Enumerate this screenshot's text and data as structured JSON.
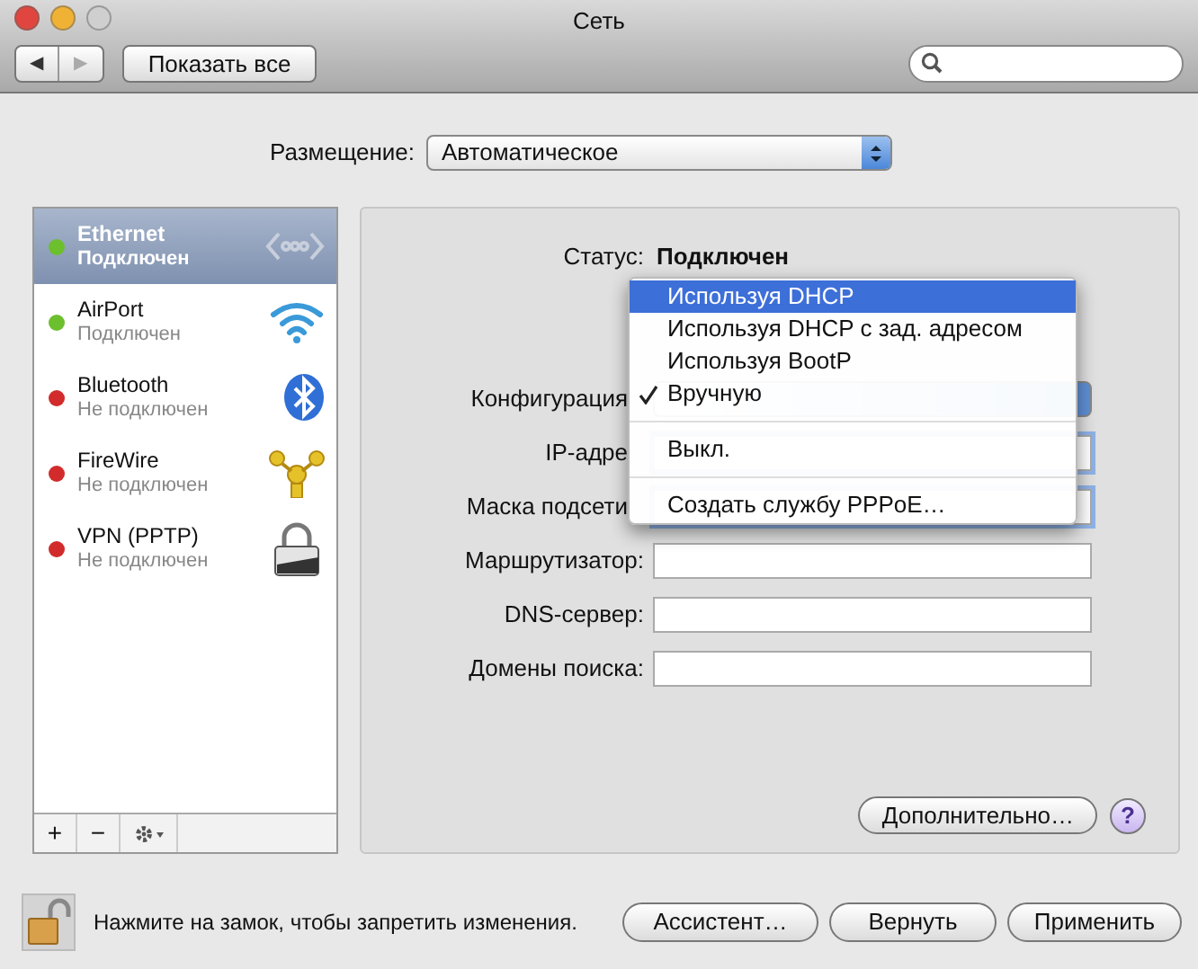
{
  "window": {
    "title": "Сеть"
  },
  "toolbar": {
    "nav": [
      {
        "label": "◀",
        "disabled": false
      },
      {
        "label": "▶",
        "disabled": true
      }
    ],
    "show_all": "Показать все"
  },
  "location": {
    "label": "Размещение:",
    "value": "Автоматическое"
  },
  "services": [
    {
      "name": "Ethernet",
      "status": "Подключен",
      "connected": true,
      "selected": true,
      "kind": "ethernet"
    },
    {
      "name": "AirPort",
      "status": "Подключен",
      "connected": true,
      "selected": false,
      "kind": "wifi"
    },
    {
      "name": "Bluetooth",
      "status": "Не подключен",
      "connected": false,
      "selected": false,
      "kind": "bluetooth"
    },
    {
      "name": "FireWire",
      "status": "Не подключен",
      "connected": false,
      "selected": false,
      "kind": "firewire"
    },
    {
      "name": "VPN (PPTP)",
      "status": "Не подключен",
      "connected": false,
      "selected": false,
      "kind": "vpn"
    }
  ],
  "list_buttons": [
    {
      "kind": "add",
      "label": "+"
    },
    {
      "kind": "remove",
      "label": "−"
    },
    {
      "kind": "gear"
    }
  ],
  "detail": {
    "status_label": "Статус:",
    "status_value": "Подключен",
    "fields": [
      {
        "label": "Конфигурация",
        "kind": "popup",
        "covered": true
      },
      {
        "label": "IP-адре",
        "kind": "text",
        "covered": true
      },
      {
        "label": "Маска подсети",
        "kind": "text",
        "covered": true
      },
      {
        "label": "Маршрутизатор:",
        "kind": "text",
        "covered": false
      },
      {
        "label": "DNS-сервер:",
        "kind": "text",
        "covered": false
      },
      {
        "label": "Домены поиска:",
        "kind": "text",
        "covered": false
      }
    ],
    "menu": [
      {
        "kind": "item",
        "label": "Используя DHCP",
        "selected": true,
        "checked": false
      },
      {
        "kind": "item",
        "label": "Используя DHCP с зад. адресом",
        "selected": false,
        "checked": false
      },
      {
        "kind": "item",
        "label": "Используя BootP",
        "selected": false,
        "checked": false
      },
      {
        "kind": "item",
        "label": "Вручную",
        "selected": false,
        "checked": true
      },
      {
        "kind": "separator"
      },
      {
        "kind": "item",
        "label": "Выкл.",
        "selected": false,
        "checked": false
      },
      {
        "kind": "separator"
      },
      {
        "kind": "item",
        "label": "Создать службу PPPoE…",
        "selected": false,
        "checked": false
      }
    ],
    "advanced": "Дополнительно…",
    "help": "?"
  },
  "footer": {
    "lock_text": "Нажмите на замок, чтобы запретить изменения.",
    "buttons": [
      "Ассистент…",
      "Вернуть",
      "Применить"
    ]
  }
}
